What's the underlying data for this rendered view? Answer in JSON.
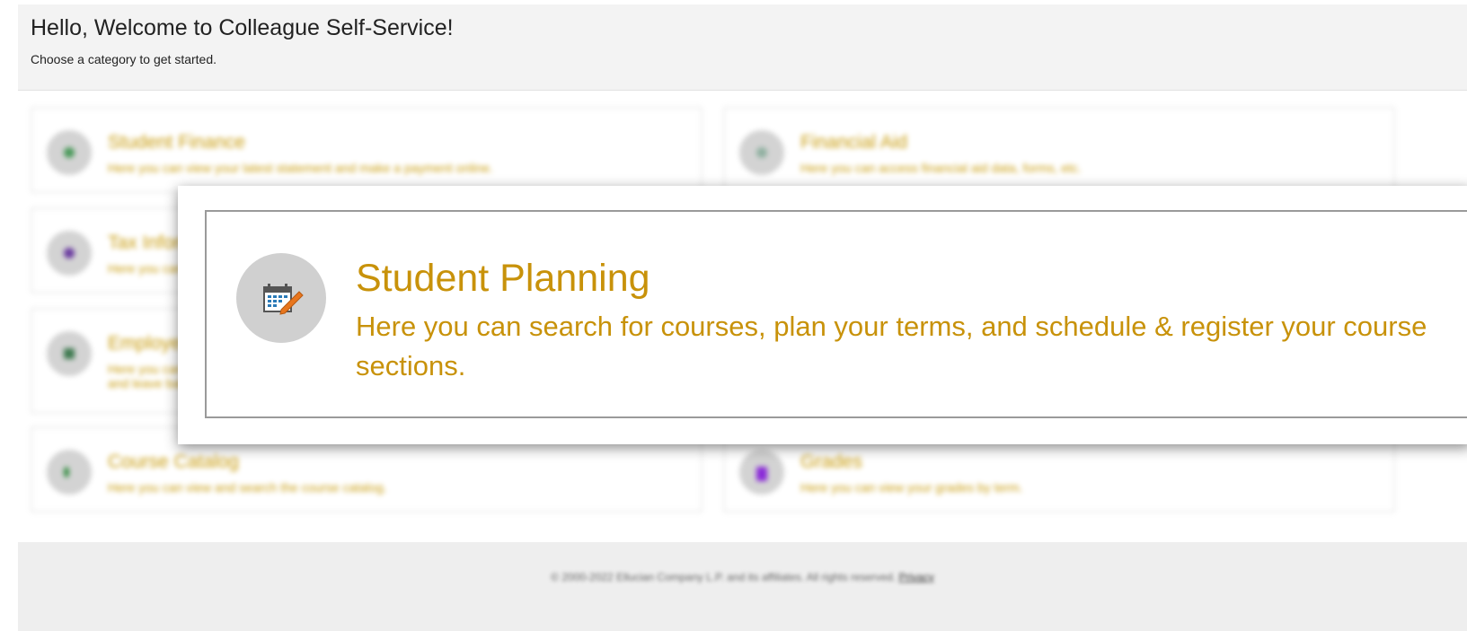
{
  "header": {
    "title": "Hello, Welcome to Colleague Self-Service!",
    "subtitle": "Choose a category to get started."
  },
  "tiles": [
    {
      "title": "Student Finance",
      "description": "Here you can view your latest statement and make a payment online.",
      "icon": "finance-icon",
      "icon_color": "#4a9a5a"
    },
    {
      "title": "Financial Aid",
      "description": "Here you can access financial aid data, forms, etc.",
      "icon": "financial-aid-icon",
      "icon_color": "#8fb0a0"
    },
    {
      "title": "Tax Information",
      "description": "Here you can change your consent for e-delivery of tax information.",
      "icon": "tax-icon",
      "icon_color": "#6a3aa0"
    },
    {
      "title": "Employee",
      "description": "Here you can view your tax form consents, earnings statements, banking information, timecards and leave balances.",
      "icon": "employee-icon",
      "icon_color": "#3f7a50"
    },
    {
      "title": "Course Catalog",
      "description": "Here you can view and search the course catalog.",
      "icon": "catalog-icon",
      "icon_color": "#2e8a3c"
    },
    {
      "title": "Grades",
      "description": "Here you can view your grades by term.",
      "icon": "grades-icon",
      "icon_color": "#8a2ad8"
    }
  ],
  "callout": {
    "title": "Student Planning",
    "description": "Here you can search for courses, plan your terms, and schedule & register your course sections.",
    "icon": "calendar-edit-icon"
  },
  "footer": {
    "copyright": "© 2000-2022 Ellucian Company L.P. and its affiliates. All rights reserved.",
    "privacy_link": "Privacy"
  },
  "colors": {
    "accent": "#c8920a",
    "background": "#f3f3f3"
  }
}
